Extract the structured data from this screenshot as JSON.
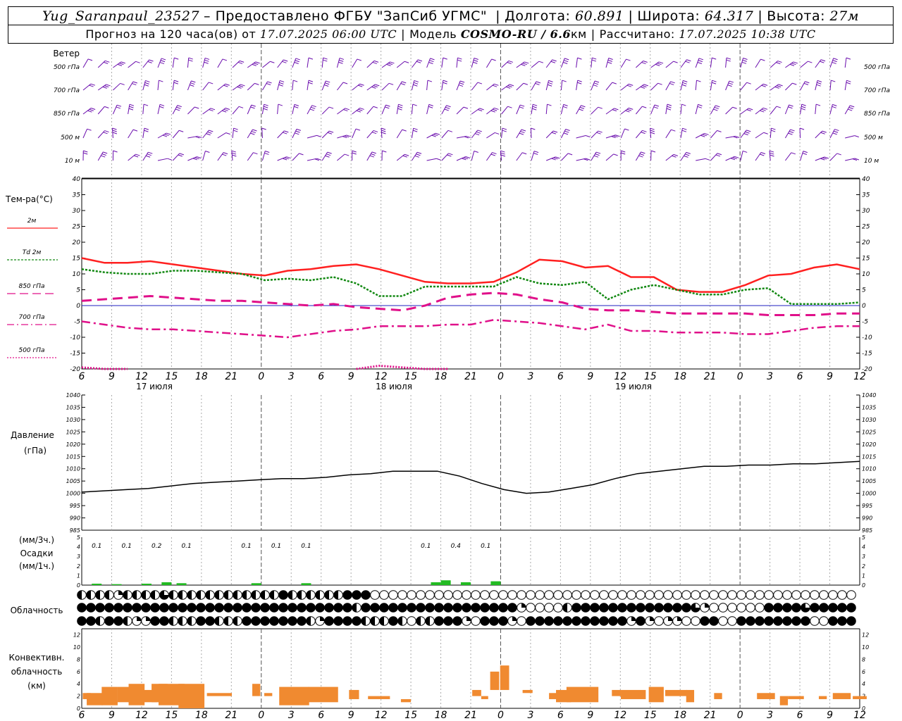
{
  "header": {
    "station": "Yug_Saranpaul_23527",
    "provider": "– Предоставлено ФГБУ \"ЗапСиб УГМС\"",
    "lon_label": "Долгота:",
    "lon": "60.891",
    "lat_label": "Широта:",
    "lat": "64.317",
    "alt_label": "Высота:",
    "alt": "27м",
    "forecast_prefix": "Прогноз на 120 часа(ов) от",
    "run_time": "17.07.2025 06:00 UTC",
    "model_label": "Модель",
    "model": "COSMO-RU / 6.6",
    "model_unit": "км",
    "calc_label": "Рассчитано:",
    "calc_time": "17.07.2025 10:38 UTC"
  },
  "wind_panel": {
    "title": "Ветер",
    "levels": [
      "500 гПа",
      "700 гПа",
      "850 гПа",
      "500 м",
      "10 м"
    ]
  },
  "temp_panel": {
    "title": "Тем-ра(°С)",
    "legend": [
      {
        "label": "2м",
        "color": "#ff2020",
        "dash": "none"
      },
      {
        "label": "Td  2м",
        "color": "#118811",
        "dash": "3,2"
      },
      {
        "label": "850 гПа",
        "color": "#e0108a",
        "dash": "12,6"
      },
      {
        "label": "700 гПа",
        "color": "#e0108a",
        "dash": "10,4,2,4"
      },
      {
        "label": "500 гПа",
        "color": "#e0108a",
        "dash": "2,2"
      }
    ]
  },
  "pressure_panel": {
    "title": "Давление",
    "unit": "(гПа)"
  },
  "precip_panel": {
    "unit1": "(мм/3ч.)",
    "title": "Осадки",
    "unit2": "(мм/1ч.)"
  },
  "cloud_panel": {
    "title": "Облачность"
  },
  "conv_panel": {
    "title1": "Конвективн.",
    "title2": "облачность",
    "unit": "(км)"
  },
  "day_labels": [
    "17 июля",
    "18 июля",
    "19 июля"
  ],
  "x_ticks": [
    "6",
    "9",
    "12",
    "15",
    "18",
    "21",
    "0",
    "3",
    "6",
    "9",
    "12",
    "15",
    "18",
    "21",
    "0",
    "3",
    "6",
    "9",
    "12",
    "15",
    "18",
    "21",
    "0",
    "3",
    "6",
    "9",
    "12"
  ],
  "chart_data": [
    {
      "type": "line",
      "title": "Тем-ра(°С)",
      "x_hours": [
        0,
        3,
        6,
        9,
        12,
        15,
        18,
        21,
        24,
        27,
        30,
        33,
        36,
        39,
        42,
        45,
        48,
        51,
        54,
        57,
        60,
        63,
        66,
        69,
        72,
        75,
        78
      ],
      "ylim": [
        -20,
        40
      ],
      "y_ticks": [
        40,
        35,
        30,
        25,
        20,
        15,
        10,
        5,
        0,
        -5,
        -10,
        -15,
        -20
      ],
      "series": [
        {
          "name": "2м",
          "values": [
            15,
            13.5,
            13.5,
            14,
            13,
            12,
            11,
            10,
            9.5,
            11,
            11.5,
            12.5,
            13,
            11.5,
            9.5,
            7.5,
            7,
            7,
            7.5,
            10.5,
            14.5,
            14,
            12,
            12.5,
            9,
            9,
            5,
            4.3,
            4.3,
            6.5,
            9.5,
            10,
            12,
            13,
            11.5
          ]
        },
        {
          "name": "Td 2м",
          "values": [
            11.5,
            10.5,
            10,
            10,
            11,
            11,
            10.5,
            10,
            8,
            8.5,
            8,
            9,
            7,
            3,
            3,
            6,
            6,
            6,
            6,
            9,
            7,
            6.5,
            7.5,
            2,
            5,
            6.5,
            5,
            3.5,
            3.5,
            5,
            5.5,
            0.5,
            0.5,
            0.5,
            1
          ]
        },
        {
          "name": "850 гПа",
          "values": [
            1.5,
            2,
            2.5,
            3,
            2.5,
            2,
            1.5,
            1.5,
            1,
            0.5,
            0,
            0.5,
            -0.5,
            -1,
            -1.5,
            0,
            2.5,
            3.5,
            4,
            3.5,
            2,
            1,
            -1,
            -1.5,
            -1.5,
            -2,
            -2.5,
            -2.5,
            -2.5,
            -2.5,
            -3,
            -3,
            -3,
            -2.5,
            -2.5
          ]
        },
        {
          "name": "700 гПа",
          "values": [
            -5,
            -6,
            -7,
            -7.5,
            -7.5,
            -8,
            -8.5,
            -9,
            -9.5,
            -10,
            -9,
            -8,
            -7.5,
            -6.5,
            -6.5,
            -6.5,
            -6,
            -6,
            -4.5,
            -5,
            -5.5,
            -6.5,
            -7.5,
            -6,
            -8,
            -8,
            -8.5,
            -8.5,
            -8.5,
            -9,
            -9,
            -8,
            -7,
            -6.5,
            -6.5
          ]
        },
        {
          "name": "500 гПа",
          "values": [
            -19.5,
            -20,
            -20,
            null,
            null,
            null,
            null,
            null,
            null,
            null,
            null,
            null,
            -20,
            -19,
            -19.5,
            -20,
            -20,
            null,
            null,
            null,
            null,
            null,
            null,
            null,
            null,
            null,
            null,
            null,
            null,
            null,
            null,
            null,
            null,
            null,
            -20
          ]
        }
      ]
    },
    {
      "type": "line",
      "title": "Давление",
      "ylim": [
        985,
        1040
      ],
      "y_ticks": [
        1040,
        1035,
        1030,
        1025,
        1020,
        1015,
        1010,
        1005,
        1000,
        995,
        990,
        985
      ],
      "values": [
        1000.5,
        1001,
        1001.5,
        1002,
        1003,
        1004,
        1004.5,
        1005,
        1005.5,
        1006,
        1006,
        1006.5,
        1007.5,
        1008,
        1009,
        1009,
        1009,
        1007,
        1004,
        1001.5,
        1000,
        1000.5,
        1002,
        1003.5,
        1006,
        1008,
        1009,
        1010,
        1011,
        1011,
        1011.5,
        1011.5,
        1012,
        1012,
        1012.5,
        1013
      ]
    },
    {
      "type": "bar",
      "title": "Осадки",
      "ylim": [
        0,
        5
      ],
      "labels_3h": [
        {
          "hour": 1.5,
          "text": "0.1"
        },
        {
          "hour": 4.5,
          "text": "0.1"
        },
        {
          "hour": 7.5,
          "text": "0.2"
        },
        {
          "hour": 10.5,
          "text": "0.1"
        },
        {
          "hour": 16.5,
          "text": "0.1"
        },
        {
          "hour": 19.5,
          "text": "0.1"
        },
        {
          "hour": 22.5,
          "text": "0.1"
        },
        {
          "hour": 34.5,
          "text": "0.1"
        },
        {
          "hour": 37.5,
          "text": "0.4"
        },
        {
          "hour": 40.5,
          "text": "0.1"
        }
      ],
      "hourly": [
        {
          "hour": 1.5,
          "value": 0.15
        },
        {
          "hour": 3.5,
          "value": 0.1
        },
        {
          "hour": 6.5,
          "value": 0.15
        },
        {
          "hour": 8.5,
          "value": 0.3
        },
        {
          "hour": 10,
          "value": 0.2
        },
        {
          "hour": 17.5,
          "value": 0.2
        },
        {
          "hour": 22.5,
          "value": 0.2
        },
        {
          "hour": 35.5,
          "value": 0.3
        },
        {
          "hour": 36.5,
          "value": 0.5
        },
        {
          "hour": 38.5,
          "value": 0.3
        },
        {
          "hour": 41.5,
          "value": 0.4
        }
      ],
      "y_ticks": [
        5,
        4,
        3,
        2,
        1,
        0
      ]
    },
    {
      "type": "bar",
      "title": "Конвективн. облачность",
      "ylim": [
        0,
        13
      ],
      "y_ticks": [
        12,
        10,
        8,
        6,
        4,
        2,
        0
      ],
      "segments": [
        {
          "h": 0.5,
          "w": 0.8,
          "b": 1.5,
          "t": 2.5
        },
        {
          "h": 1.3,
          "w": 1.6,
          "b": 0.5,
          "t": 2.5
        },
        {
          "h": 2.8,
          "w": 1.6,
          "b": 0.5,
          "t": 3.5
        },
        {
          "h": 4.4,
          "w": 1.6,
          "b": 1,
          "t": 3.5
        },
        {
          "h": 5.5,
          "w": 1.6,
          "b": 0.5,
          "t": 4
        },
        {
          "h": 6.8,
          "w": 1.6,
          "b": 1,
          "t": 3
        },
        {
          "h": 7.8,
          "w": 1.6,
          "b": 1,
          "t": 4
        },
        {
          "h": 9,
          "w": 2.6,
          "b": 0.5,
          "t": 4
        },
        {
          "h": 11,
          "w": 2.6,
          "b": 0,
          "t": 4
        },
        {
          "h": 13.8,
          "w": 2.5,
          "b": 2,
          "t": 2.5
        },
        {
          "h": 17.5,
          "w": 0.8,
          "b": 2,
          "t": 4
        },
        {
          "h": 18.7,
          "w": 0.8,
          "b": 2,
          "t": 2.5
        },
        {
          "h": 21.3,
          "w": 3,
          "b": 0.5,
          "t": 3.5
        },
        {
          "h": 24.2,
          "w": 3,
          "b": 1,
          "t": 3.5
        },
        {
          "h": 27.3,
          "w": 1,
          "b": 1.5,
          "t": 3
        },
        {
          "h": 29.8,
          "w": 2.2,
          "b": 1.5,
          "t": 2
        },
        {
          "h": 32.5,
          "w": 1,
          "b": 1,
          "t": 1.5
        },
        {
          "h": 39.6,
          "w": 0.9,
          "b": 2,
          "t": 3
        },
        {
          "h": 40.4,
          "w": 0.7,
          "b": 1.5,
          "t": 2
        },
        {
          "h": 41.4,
          "w": 0.9,
          "b": 3,
          "t": 6
        },
        {
          "h": 42.4,
          "w": 0.9,
          "b": 3,
          "t": 7
        },
        {
          "h": 44.7,
          "w": 1,
          "b": 2.5,
          "t": 3
        },
        {
          "h": 47.3,
          "w": 0.9,
          "b": 1.5,
          "t": 2.5
        },
        {
          "h": 48.3,
          "w": 1.5,
          "b": 1,
          "t": 3
        },
        {
          "h": 50.2,
          "w": 3.2,
          "b": 1,
          "t": 3.5
        },
        {
          "h": 53.6,
          "w": 0.9,
          "b": 2,
          "t": 3
        },
        {
          "h": 55.3,
          "w": 2.5,
          "b": 1.5,
          "t": 3
        },
        {
          "h": 57.6,
          "w": 1.5,
          "b": 1,
          "t": 3.5
        },
        {
          "h": 59.6,
          "w": 2.2,
          "b": 2,
          "t": 3
        },
        {
          "h": 61,
          "w": 0.8,
          "b": 1,
          "t": 3
        },
        {
          "h": 63.8,
          "w": 0.8,
          "b": 1.5,
          "t": 2.5
        },
        {
          "h": 68.6,
          "w": 1.8,
          "b": 1.5,
          "t": 2.5
        },
        {
          "h": 70.4,
          "w": 0.8,
          "b": 0.5,
          "t": 2
        },
        {
          "h": 71.6,
          "w": 1.6,
          "b": 1.5,
          "t": 2
        },
        {
          "h": 74.3,
          "w": 0.8,
          "b": 1.5,
          "t": 2
        },
        {
          "h": 76.2,
          "w": 1.8,
          "b": 1.5,
          "t": 2.5
        },
        {
          "h": 78,
          "w": 1.4,
          "b": 1.5,
          "t": 2
        }
      ]
    }
  ],
  "clouds": {
    "rows": [
      "hhhhqhhhh3hhhhhhhhhhhhfhhhhhhfffeeeeeeeeeeeeeeeeeeeeeeeeeeeeeeeeeeeeeeeeeeeeeeeeeeeeeeeeeeeeeeeeeeeeeeeeee",
      "ffffffffffffffffffffffffffffffhfffffffffffffffffqeeeehfffffffffffff3qeeeeeeffff3ffffffffffqfeeeqeeqeeqeeeeeeeeeeeeeeqhe",
      "ffhffhqqffhhhffhhhfffffffhqffffhhhfhehhfffqefffqefffffffffffqfqeqqeeffeeffffffffeeffffffqqeqqeqqhhqeqeqeeeeeeeeeeeqhf"
    ]
  },
  "colors": {
    "wind": "#6a0dad",
    "temp2m": "#ff2020",
    "td": "#118811",
    "upper": "#e0108a",
    "zero_line": "#2020c0",
    "precip": "#22bb22",
    "conv": "#f08a30"
  }
}
